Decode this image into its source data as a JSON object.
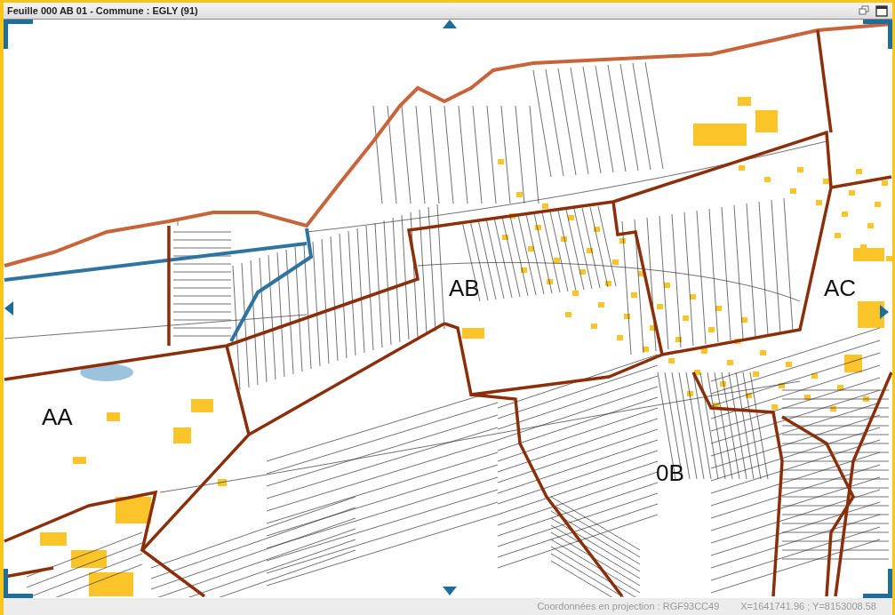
{
  "window": {
    "title": "Feuille 000 AB 01 - Commune : EGLY (91)"
  },
  "map": {
    "sections": [
      {
        "label": "AB"
      },
      {
        "label": "AC"
      },
      {
        "label": "AA"
      },
      {
        "label": "0B"
      }
    ]
  },
  "status_bar": {
    "projection": "Coordonnées en projection : RGF93CC49",
    "coordinates": "X=1641741.96 ; Y=8153008.58"
  }
}
